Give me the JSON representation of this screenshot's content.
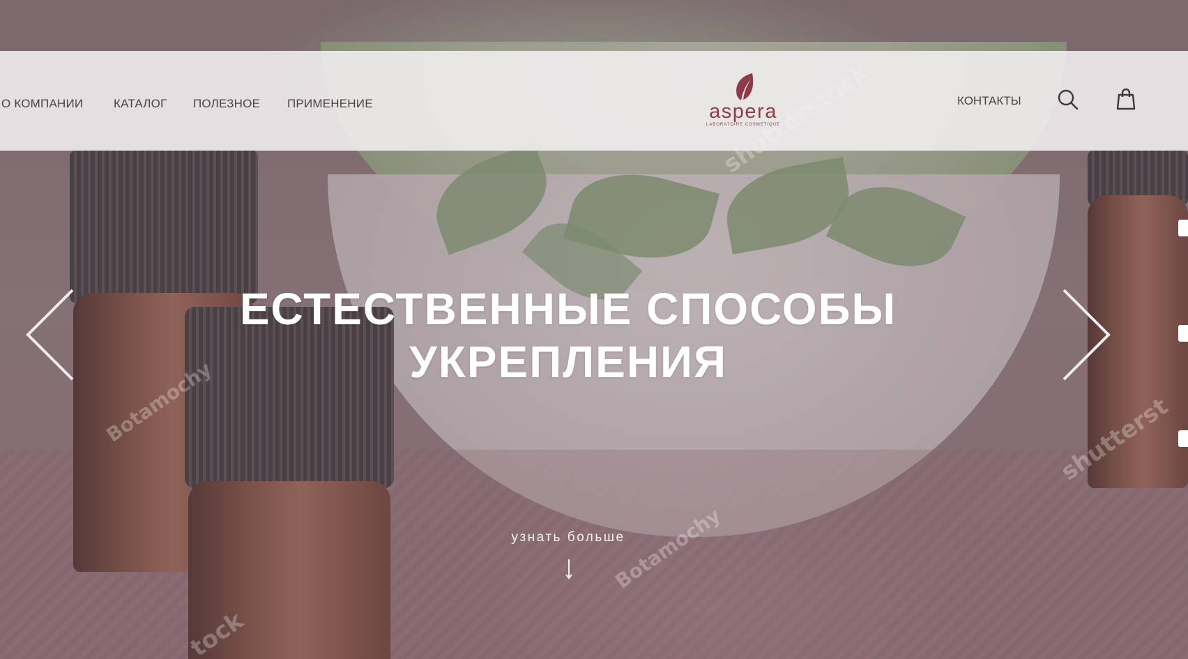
{
  "header": {
    "nav": [
      {
        "label": "О КОМПАНИИ"
      },
      {
        "label": "КАТАЛОГ"
      },
      {
        "label": "ПОЛЕЗНОЕ"
      },
      {
        "label": "ПРИМЕНЕНИЕ"
      }
    ],
    "logo": {
      "name": "aspera",
      "subtitle": "LABORATOIRE COSMETIQUE"
    },
    "contacts_label": "КОНТАКТЫ",
    "icons": {
      "search": "search-icon",
      "cart": "shopping-bag-icon"
    }
  },
  "hero": {
    "headline_line1": "ЕСТЕСТВЕННЫЕ СПОСОБЫ",
    "headline_line2": "УКРЕПЛЕНИЯ",
    "cta_label": "узнать больше",
    "watermarks": [
      "shutterstock",
      "Botamochy",
      "Botamochy",
      "shutterst",
      "tock"
    ]
  },
  "colors": {
    "brand": "#8e3b49",
    "nav_text": "#4b4245",
    "header_bg": "#f3f0f1"
  }
}
